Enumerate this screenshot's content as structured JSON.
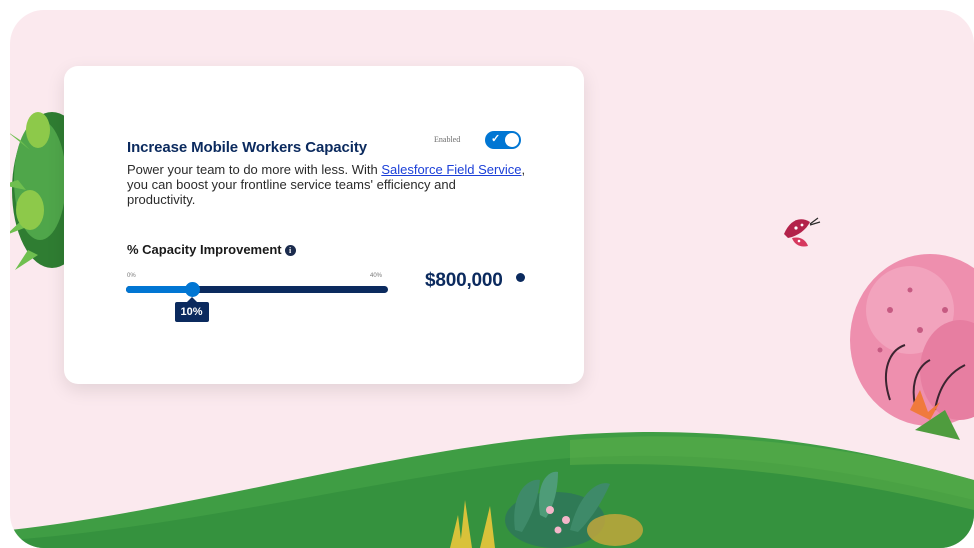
{
  "card": {
    "title": "Increase Mobile Workers Capacity",
    "toggle_label": "Enabled",
    "toggle_on": true,
    "description_before": "Power your team to do more with less. With ",
    "description_link": "Salesforce Field Service",
    "description_after": ", you can boost your frontline service teams' efficiency and productivity.",
    "slider": {
      "label": "% Capacity Improvement",
      "min_label": "0%",
      "max_label": "40%",
      "min": 0,
      "max": 40,
      "value": 10,
      "value_label": "10%"
    },
    "amount": "$800,000"
  },
  "colors": {
    "background": "#fbe9ee",
    "primary_blue": "#0176d3",
    "navy": "#0b2a5e",
    "hill_green": "#3f9d44"
  },
  "icons": [
    "info-icon",
    "check-icon",
    "butterfly-icon"
  ]
}
